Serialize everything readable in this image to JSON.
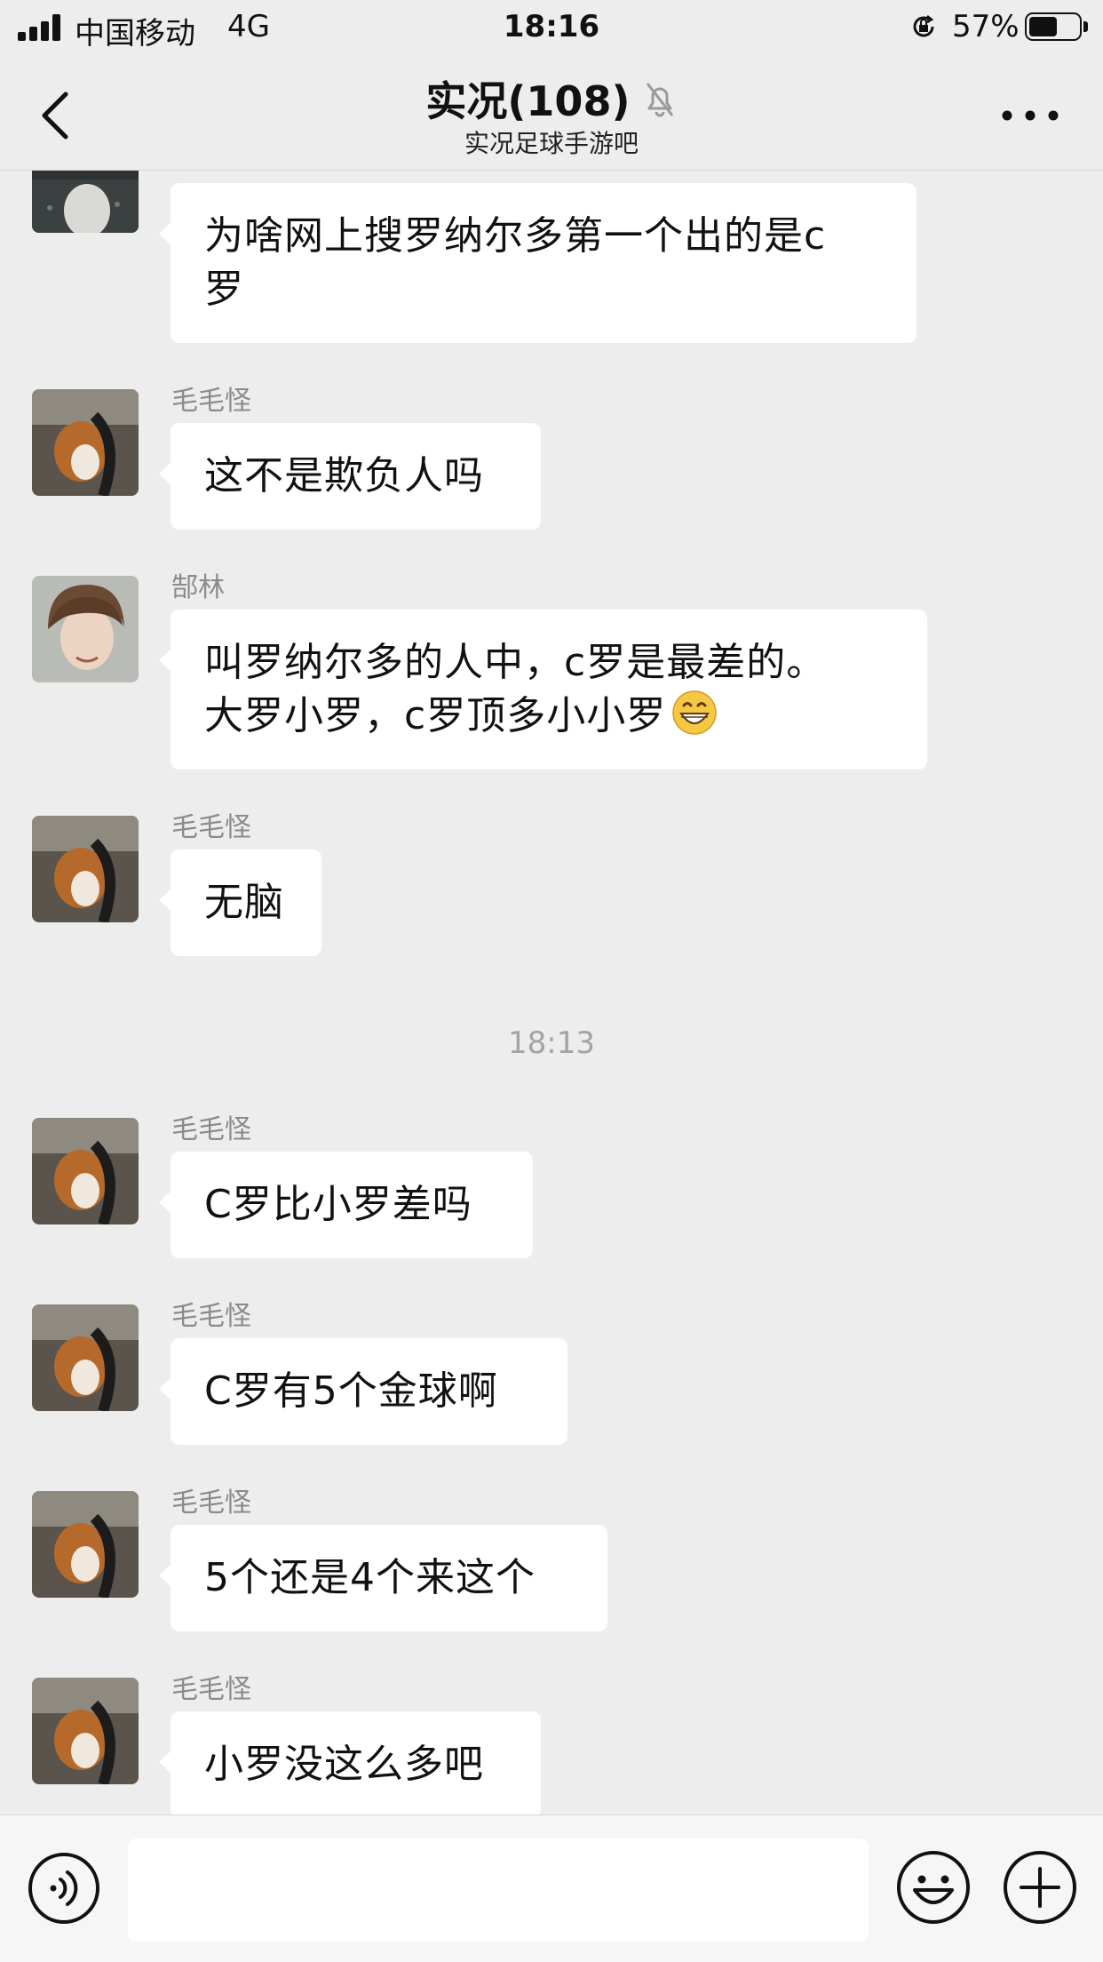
{
  "status_bar": {
    "carrier": "中国移动",
    "network": "4G",
    "time": "18:16",
    "battery_percent": "57%",
    "battery_level": 0.57
  },
  "nav": {
    "title": "实况(108)",
    "subtitle": "实况足球手游吧"
  },
  "messages": [
    {
      "sender": "",
      "text": "为啥网上搜罗纳尔多第一个出的是c\n罗"
    },
    {
      "sender": "毛毛怪",
      "text": "这不是欺负人吗"
    },
    {
      "sender": "郜林",
      "text": "叫罗纳尔多的人中，c罗是最差的。\n大罗小罗，c罗顶多小小罗",
      "emoji": "grinning-emoji"
    },
    {
      "sender": "毛毛怪",
      "text": "无脑"
    },
    {
      "sender": "毛毛怪",
      "text": "C罗比小罗差吗"
    },
    {
      "sender": "毛毛怪",
      "text": "C罗有5个金球啊"
    },
    {
      "sender": "毛毛怪",
      "text": "5个还是4个来这个"
    },
    {
      "sender": "毛毛怪",
      "text": "小罗没这么多吧"
    }
  ],
  "timestamp": "18:13",
  "input_bar": {
    "voice_icon": "voice-icon",
    "emoji_icon": "emoji-icon",
    "plus_icon": "plus-icon",
    "text_value": ""
  },
  "colors": {
    "background": "#ededed",
    "bubble": "#ffffff",
    "sender": "#8b8b8b",
    "timestamp": "#a3a3a3"
  }
}
